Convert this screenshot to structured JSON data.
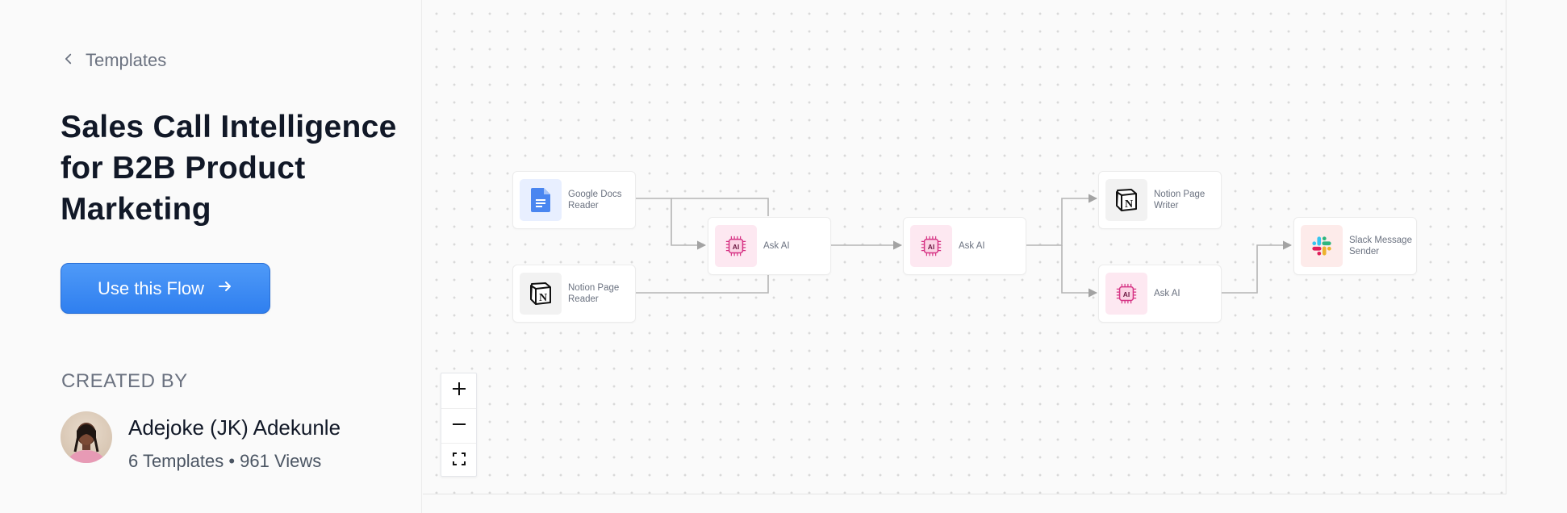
{
  "back_link": {
    "label": "Templates"
  },
  "title": "Sales Call Intelligence for B2B Product Marketing",
  "cta": {
    "label": "Use this Flow"
  },
  "creator": {
    "section_label": "CREATED BY",
    "name": "Adejoke (JK) Adekunle",
    "stats": "6 Templates • 961 Views"
  },
  "flow": {
    "nodes": [
      {
        "id": "google-docs-reader",
        "label": "Google Docs Reader",
        "icon": "google-docs-icon"
      },
      {
        "id": "notion-page-reader",
        "label": "Notion Page Reader",
        "icon": "notion-icon"
      },
      {
        "id": "ask-ai-1",
        "label": "Ask AI",
        "icon": "ai-chip-icon"
      },
      {
        "id": "ask-ai-2",
        "label": "Ask AI",
        "icon": "ai-chip-icon"
      },
      {
        "id": "notion-page-writer",
        "label": "Notion Page Writer",
        "icon": "notion-icon"
      },
      {
        "id": "ask-ai-3",
        "label": "Ask AI",
        "icon": "ai-chip-icon"
      },
      {
        "id": "slack-message-sender",
        "label": "Slack Message Sender",
        "icon": "slack-icon"
      }
    ]
  },
  "zoom_controls": [
    "zoom-in-icon",
    "zoom-out-icon",
    "fit-view-icon"
  ],
  "colors": {
    "accent": "#3b8bf5",
    "ai_pink": "#d63384",
    "canvas_dot": "#d9d9d9"
  }
}
